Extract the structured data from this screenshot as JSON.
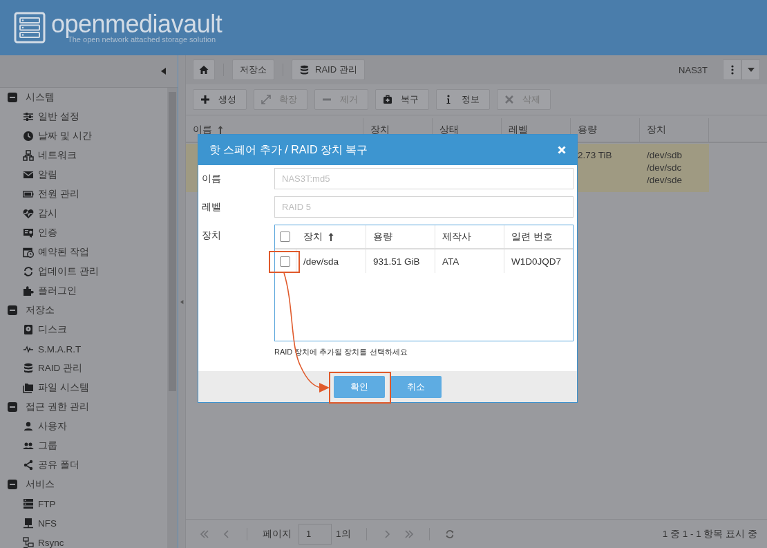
{
  "header": {
    "logo_title": "openmediavault",
    "logo_subtitle": "The open network attached storage solution"
  },
  "breadcrumbs": [
    {
      "label": "저장소",
      "icon": false
    },
    {
      "label": "RAID 관리",
      "icon": true
    }
  ],
  "hostname": "NAS3T",
  "sidebar": {
    "groups": [
      {
        "label": "시스템",
        "expanded": true,
        "children": [
          {
            "label": "일반 설정"
          },
          {
            "label": "날짜 및 시간"
          },
          {
            "label": "네트워크"
          },
          {
            "label": "알림"
          },
          {
            "label": "전원 관리"
          },
          {
            "label": "감시"
          },
          {
            "label": "인증"
          },
          {
            "label": "예약된 작업"
          },
          {
            "label": "업데이트 관리"
          },
          {
            "label": "플러그인"
          }
        ]
      },
      {
        "label": "저장소",
        "expanded": true,
        "children": [
          {
            "label": "디스크"
          },
          {
            "label": "S.M.A.R.T"
          },
          {
            "label": "RAID 관리"
          },
          {
            "label": "파일 시스템"
          }
        ]
      },
      {
        "label": "접근 권한 관리",
        "expanded": true,
        "children": [
          {
            "label": "사용자"
          },
          {
            "label": "그룹"
          },
          {
            "label": "공유 폴더"
          }
        ]
      },
      {
        "label": "서비스",
        "expanded": true,
        "children": [
          {
            "label": "FTP"
          },
          {
            "label": "NFS"
          },
          {
            "label": "Rsync"
          }
        ]
      }
    ]
  },
  "toolbar": [
    {
      "label": "생성",
      "disabled": false
    },
    {
      "label": "확장",
      "disabled": true
    },
    {
      "label": "제거",
      "disabled": true
    },
    {
      "label": "복구",
      "disabled": false
    },
    {
      "label": "정보",
      "disabled": false
    },
    {
      "label": "삭제",
      "disabled": true
    }
  ],
  "table": {
    "columns": [
      {
        "label": "이름",
        "sorted": true
      },
      {
        "label": "장치",
        "sorted": false
      },
      {
        "label": "상태",
        "sorted": false
      },
      {
        "label": "레벨",
        "sorted": false
      },
      {
        "label": "용량",
        "sorted": false
      },
      {
        "label": "장치",
        "sorted": false
      }
    ],
    "rows": [
      {
        "selected": true,
        "capacity": "2.73 TiB",
        "devices": [
          "/dev/sdb",
          "/dev/sdc",
          "/dev/sde"
        ]
      }
    ]
  },
  "pagination": {
    "page_label": "페이지",
    "page": "1",
    "of_label": "1의",
    "summary": "1 중 1 - 1 항목 표시 중"
  },
  "dialog": {
    "title": "핫 스페어 추가 / RAID 장치 복구",
    "fields": [
      {
        "label": "이름",
        "value": "NAS3T:md5",
        "disabled": true
      },
      {
        "label": "레벨",
        "value": "RAID 5",
        "disabled": true
      }
    ],
    "device_label": "장치",
    "device_grid": {
      "select_all_checked": false,
      "columns": [
        {
          "label": "장치",
          "sorted": true
        },
        {
          "label": "용량",
          "sorted": false
        },
        {
          "label": "제작사",
          "sorted": false
        },
        {
          "label": "일련 번호",
          "sorted": false
        }
      ],
      "rows": [
        {
          "checked": false,
          "cells": [
            "/dev/sda",
            "931.51 GiB",
            "ATA",
            "W1D0JQD7"
          ]
        }
      ]
    },
    "hint": "RAID 장치에 추가될 장치를 선택하세요",
    "buttons": [
      {
        "label": "확인"
      },
      {
        "label": "취소"
      }
    ]
  }
}
